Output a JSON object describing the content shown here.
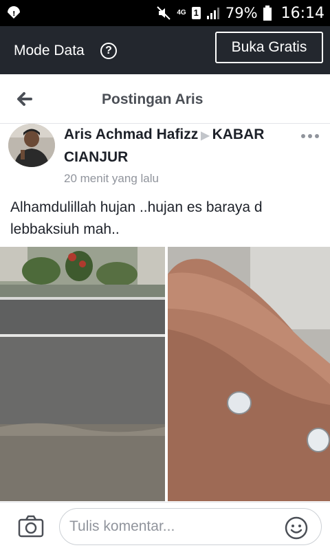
{
  "status_bar": {
    "network": "4G",
    "sim": "1",
    "battery_percent": "79%",
    "time": "16:14"
  },
  "mode_bar": {
    "label": "Mode Data",
    "help_symbol": "?",
    "free_button": "Buka Gratis"
  },
  "header": {
    "title": "Postingan Aris"
  },
  "post": {
    "author": "Aris Achmad Hafizz",
    "group": "KABAR CIANJUR",
    "timestamp": "20 menit yang lalu",
    "text": "Alhamdulillah hujan ..hujan es baraya d lebbaksiuh mah.."
  },
  "comment": {
    "placeholder": "Tulis komentar..."
  },
  "icons": {
    "back": "back-arrow-icon",
    "more": "more-options-icon",
    "camera": "camera-icon",
    "emoji": "emoji-icon"
  },
  "colors": {
    "mode_bar_bg": "#23272e",
    "title_gray": "#4b4f56",
    "meta_gray": "#90949c"
  }
}
